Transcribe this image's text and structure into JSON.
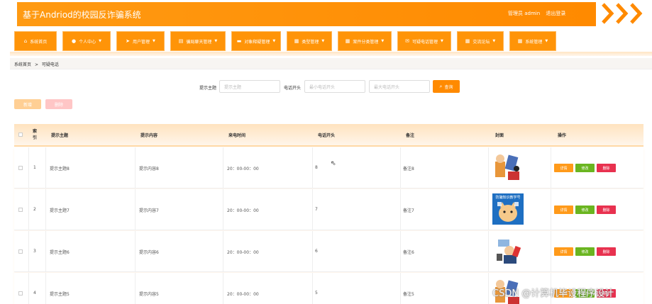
{
  "header": {
    "title": "基于Andriod的校园反诈骗系统",
    "admin_label": "管理员 admin",
    "logout_label": "退出登录"
  },
  "nav": [
    {
      "label": "系统首页",
      "icon": "home-icon",
      "glyph": "⌂",
      "dropdown": false
    },
    {
      "label": "个人中心",
      "icon": "user-icon",
      "glyph": "●",
      "dropdown": true
    },
    {
      "label": "用户管理",
      "icon": "send-icon",
      "glyph": "➤",
      "dropdown": true
    },
    {
      "label": "骗局聊天管理",
      "icon": "doc-icon",
      "glyph": "▤",
      "dropdown": true
    },
    {
      "label": "对象释疑管理",
      "icon": "list-icon",
      "glyph": "▬",
      "dropdown": true
    },
    {
      "label": "类型管理",
      "icon": "grid-icon",
      "glyph": "▦",
      "dropdown": true
    },
    {
      "label": "案件分类管理",
      "icon": "grid-icon",
      "glyph": "▦",
      "dropdown": true
    },
    {
      "label": "可疑电话管理",
      "icon": "chat-icon",
      "glyph": "✉",
      "dropdown": true
    },
    {
      "label": "交流论坛",
      "icon": "grid-icon",
      "glyph": "▦",
      "dropdown": true
    },
    {
      "label": "系统管理",
      "icon": "grid-icon",
      "glyph": "▦",
      "dropdown": true
    }
  ],
  "breadcrumb": {
    "home": "系统首页",
    "sep": ">",
    "current": "可疑电话"
  },
  "search": {
    "topic_label": "提示主题",
    "topic_placeholder": "提示主题",
    "phone_label": "电话开头",
    "phone_min_placeholder": "最小电话开头",
    "phone_max_placeholder": "最大电话开头",
    "search_label": "查询"
  },
  "toolbar": {
    "add_label": "新增",
    "delete_label": "删除"
  },
  "table": {
    "headers": {
      "index": "索引",
      "topic": "提示主题",
      "content": "提示内容",
      "time": "来电时间",
      "phone": "电话开头",
      "note": "备注",
      "cover": "封面",
      "action": "操作"
    },
    "rows": [
      {
        "index": "1",
        "topic": "提示主题8",
        "content": "提示内容8",
        "time": "20：00-00：00",
        "phone": "8",
        "note": "备注8"
      },
      {
        "index": "2",
        "topic": "提示主题7",
        "content": "提示内容7",
        "time": "20：00-00：00",
        "phone": "7",
        "note": "备注7"
      },
      {
        "index": "3",
        "topic": "提示主题6",
        "content": "提示内容6",
        "time": "20：00-00：00",
        "phone": "6",
        "note": "备注6"
      },
      {
        "index": "4",
        "topic": "提示主题5",
        "content": "提示内容5",
        "time": "20：00-00：00",
        "phone": "5",
        "note": "备注5"
      }
    ],
    "actions": {
      "detail": "详情",
      "edit": "修改",
      "delete": "删除"
    },
    "poster_caption": "防骗知识教学号"
  },
  "watermark": "CSDN @计算机毕设程序设计",
  "colors": {
    "primary": "#ff8a00",
    "edit": "#6ab520",
    "delete": "#e8314f"
  }
}
